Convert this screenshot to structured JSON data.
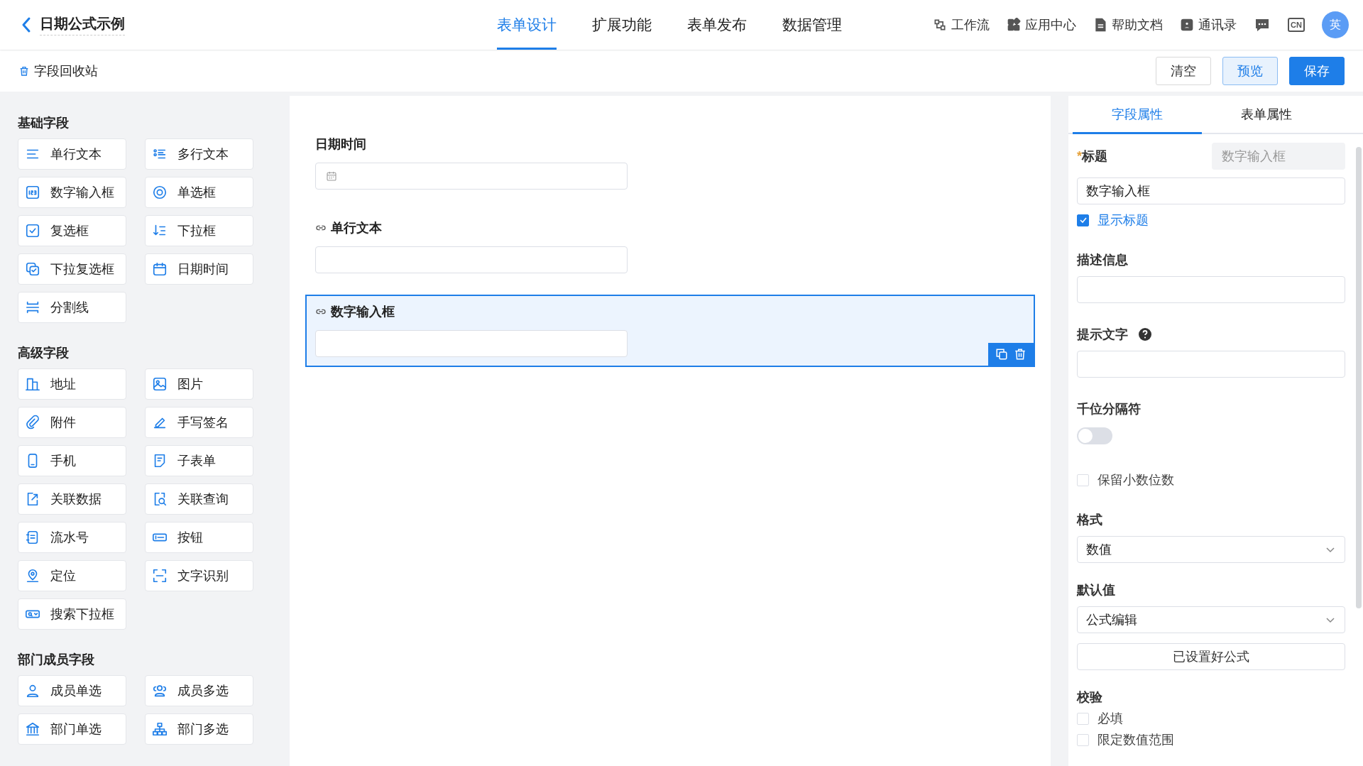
{
  "header": {
    "title": "日期公式示例",
    "tabs": [
      {
        "label": "表单设计",
        "selected": true
      },
      {
        "label": "扩展功能",
        "selected": false
      },
      {
        "label": "表单发布",
        "selected": false
      },
      {
        "label": "数据管理",
        "selected": false
      }
    ],
    "tools": [
      {
        "label": "工作流"
      },
      {
        "label": "应用中心"
      },
      {
        "label": "帮助文档"
      },
      {
        "label": "通讯录"
      }
    ],
    "language": "CN",
    "avatar": "英"
  },
  "toolbar": {
    "recycle_bin": "字段回收站",
    "buttons": [
      {
        "label": "清空",
        "kind": "default"
      },
      {
        "label": "预览",
        "kind": "light"
      },
      {
        "label": "保存",
        "kind": "primary"
      }
    ]
  },
  "field_groups": [
    {
      "title": "基础字段",
      "items": [
        "单行文本",
        "多行文本",
        "数字输入框",
        "单选框",
        "复选框",
        "下拉框",
        "下拉复选框",
        "日期时间",
        "分割线"
      ]
    },
    {
      "title": "高级字段",
      "items": [
        "地址",
        "图片",
        "附件",
        "手写签名",
        "手机",
        "子表单",
        "关联数据",
        "关联查询",
        "流水号",
        "按钮",
        "定位",
        "文字识别",
        "搜索下拉框"
      ]
    },
    {
      "title": "部门成员字段",
      "items": [
        "成员单选",
        "成员多选",
        "部门单选",
        "部门多选"
      ]
    }
  ],
  "canvas": {
    "fields": [
      {
        "label": "日期时间",
        "linked": false,
        "kind": "date",
        "selected": false
      },
      {
        "label": "单行文本",
        "linked": true,
        "kind": "text",
        "selected": false
      },
      {
        "label": "数字输入框",
        "linked": true,
        "kind": "text",
        "selected": true
      }
    ]
  },
  "properties": {
    "tabs": [
      {
        "label": "字段属性",
        "selected": true
      },
      {
        "label": "表单属性",
        "selected": false
      }
    ],
    "title_label": "标题",
    "required_mark": "*",
    "title_tag": "数字输入框",
    "title_value": "数字输入框",
    "show_title": {
      "label": "显示标题",
      "checked": true
    },
    "description_label": "描述信息",
    "hint_label": "提示文字",
    "separator": {
      "label": "千位分隔符",
      "on": false
    },
    "keep_decimals": {
      "label": "保留小数位数",
      "checked": false
    },
    "format": {
      "label": "格式",
      "value": "数值"
    },
    "default": {
      "label": "默认值",
      "value": "公式编辑"
    },
    "formula_button": "已设置好公式",
    "validation": {
      "label": "校验",
      "options": [
        {
          "label": "必填",
          "checked": false
        },
        {
          "label": "限定数值范围",
          "checked": false
        }
      ]
    }
  }
}
